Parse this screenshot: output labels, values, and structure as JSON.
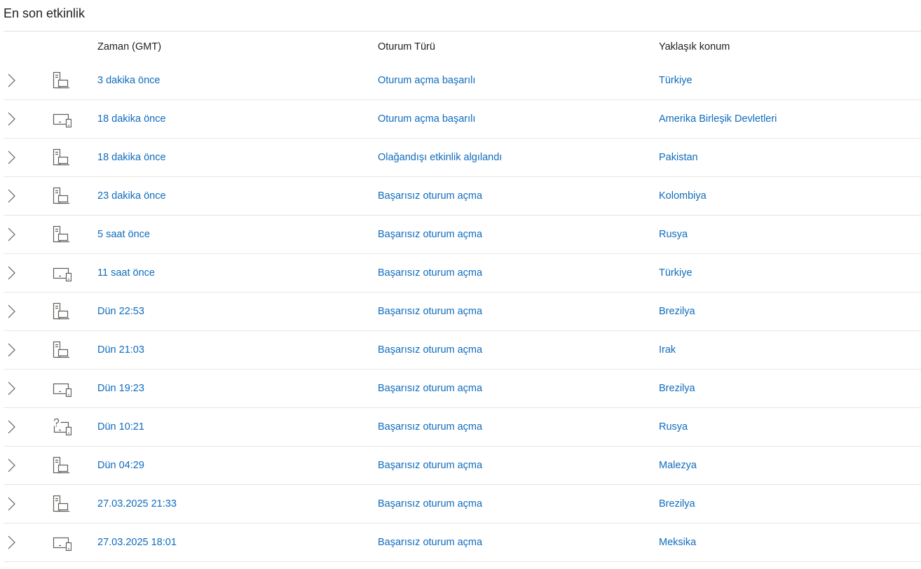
{
  "title": "En son etkinlik",
  "columns": {
    "time": "Zaman (GMT)",
    "type": "Oturum Türü",
    "location": "Yaklaşık konum"
  },
  "colors": {
    "link": "#0f6cbd",
    "text": "#201f1e",
    "divider": "#e1dfdd",
    "icon": "#605e5c"
  },
  "rows": [
    {
      "device_icon": "desktop-laptop-icon",
      "time": "3 dakika önce",
      "type": "Oturum açma başarılı",
      "location": "Türkiye"
    },
    {
      "device_icon": "monitor-phone-icon",
      "time": "18 dakika önce",
      "type": "Oturum açma başarılı",
      "location": "Amerika Birleşik Devletleri"
    },
    {
      "device_icon": "desktop-laptop-icon",
      "time": "18 dakika önce",
      "type": "Olağandışı etkinlik algılandı",
      "location": "Pakistan"
    },
    {
      "device_icon": "desktop-laptop-icon",
      "time": "23 dakika önce",
      "type": "Başarısız oturum açma",
      "location": "Kolombiya"
    },
    {
      "device_icon": "desktop-laptop-icon",
      "time": "5 saat önce",
      "type": "Başarısız oturum açma",
      "location": "Rusya"
    },
    {
      "device_icon": "monitor-phone-icon",
      "time": "11 saat önce",
      "type": "Başarısız oturum açma",
      "location": "Türkiye"
    },
    {
      "device_icon": "desktop-laptop-icon",
      "time": "Dün 22:53",
      "type": "Başarısız oturum açma",
      "location": "Brezilya"
    },
    {
      "device_icon": "desktop-laptop-icon",
      "time": "Dün 21:03",
      "type": "Başarısız oturum açma",
      "location": "Irak"
    },
    {
      "device_icon": "monitor-phone-icon",
      "time": "Dün 19:23",
      "type": "Başarısız oturum açma",
      "location": "Brezilya"
    },
    {
      "device_icon": "unknown-device-icon",
      "time": "Dün 10:21",
      "type": "Başarısız oturum açma",
      "location": "Rusya"
    },
    {
      "device_icon": "desktop-laptop-icon",
      "time": "Dün 04:29",
      "type": "Başarısız oturum açma",
      "location": "Malezya"
    },
    {
      "device_icon": "desktop-laptop-icon",
      "time": "27.03.2025 21:33",
      "type": "Başarısız oturum açma",
      "location": "Brezilya"
    },
    {
      "device_icon": "monitor-phone-icon",
      "time": "27.03.2025 18:01",
      "type": "Başarısız oturum açma",
      "location": "Meksika"
    }
  ]
}
